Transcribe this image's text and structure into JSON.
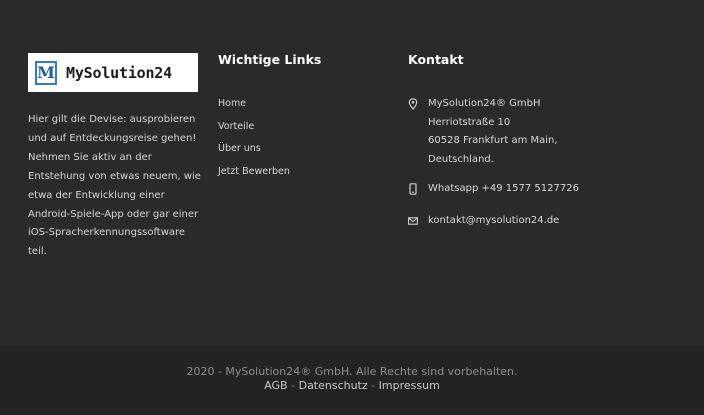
{
  "logo": {
    "mark": "M",
    "text": "MySolution24"
  },
  "about": {
    "text": "Hier gilt die Devise: ausprobieren und auf Entdeckungsreise gehen! Nehmen Sie aktiv an der Entstehung von etwas neuem, wie etwa der Entwicklung einer Android-Spiele-App oder gar einer iOS-Spracherkennungssoftware teil."
  },
  "links": {
    "title": "Wichtige Links",
    "items": [
      "Home",
      "Vorteile",
      "Über uns",
      "Jetzt Bewerben"
    ]
  },
  "contact": {
    "title": "Kontakt",
    "address": [
      "MySolution24® GmbH",
      "Herriotstraße 10",
      "60528 Frankfurt am Main,",
      "Deutschland."
    ],
    "phone": "Whatsapp +49 1577 5127726",
    "email": "kontakt@mysolution24.de",
    "icons": [
      "location-pin-icon",
      "mobile-phone-icon",
      "envelope-icon"
    ]
  },
  "bottom": {
    "copyright": "2020 - MySolution24® GmbH. Alle Rechte sind vorbehalten.",
    "legal": [
      "AGB",
      "Datenschutz",
      "Impressum"
    ],
    "separator": "-"
  }
}
